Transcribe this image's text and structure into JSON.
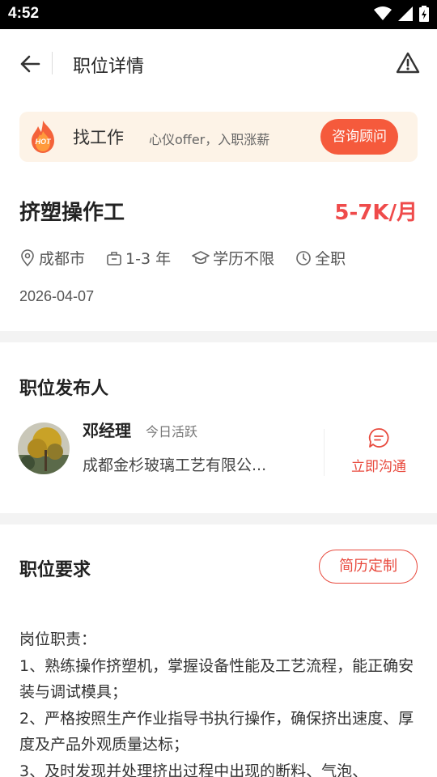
{
  "status_bar": {
    "time": "4:52"
  },
  "nav": {
    "title": "职位详情"
  },
  "banner": {
    "hot_label": "HOT",
    "title": "找工作",
    "subtitle": "心仪offer，入职涨薪",
    "consult_label": "咨询顾问"
  },
  "job": {
    "title": "挤塑操作工",
    "salary": "5-7K/月",
    "location": "成都市",
    "experience": "1-3 年",
    "education": "学历不限",
    "type": "全职",
    "date": "2026-04-07"
  },
  "publisher": {
    "section_title": "职位发布人",
    "name": "邓经理",
    "status": "今日活跃",
    "company": "成都金杉玻璃工艺有限公...",
    "chat_label": "立即沟通"
  },
  "requirements": {
    "section_title": "职位要求",
    "resume_button": "简历定制",
    "lines": [
      "岗位职责：",
      "1、熟练操作挤塑机，掌握设备性能及工艺流程，能正确安装与调试模具；",
      "2、严格按照生产作业指导书执行操作，确保挤出速度、厚度及产品外观质量达标；",
      "3、及时发现并处理挤出过程中出现的断料、气泡、"
    ]
  },
  "colors": {
    "accent": "#ef4b4b",
    "banner_bg": "#fdf3e7",
    "consult_btn": "#f55a3c"
  }
}
